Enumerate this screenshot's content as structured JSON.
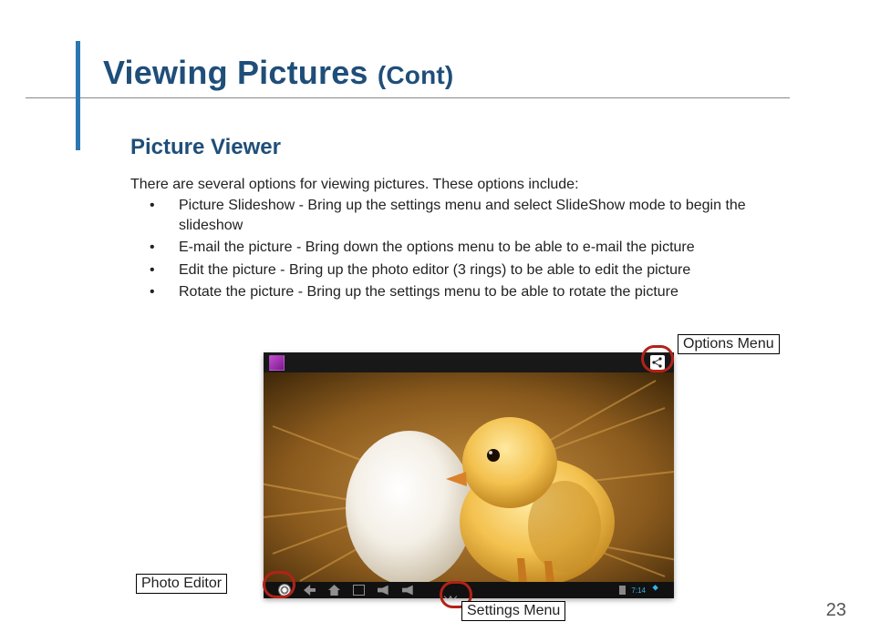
{
  "page_number": "23",
  "heading_main": "Viewing Pictures",
  "heading_suffix": "(Cont)",
  "subheading": "Picture Viewer",
  "intro": "There are several options for viewing pictures.  These options include:",
  "bullets": [
    "Picture Slideshow - Bring up the settings menu and select SlideShow mode to begin the slideshow",
    "E-mail the picture - Bring down the options menu to be able to e-mail the picture",
    "Edit the picture - Bring up the photo editor (3 rings) to be able to edit the picture",
    "Rotate the picture - Bring up the settings menu to be able to rotate the picture"
  ],
  "labels": {
    "options_menu": "Options Menu",
    "photo_editor": "Photo Editor",
    "settings_menu": "Settings Menu"
  },
  "device": {
    "clock": "7:14"
  }
}
